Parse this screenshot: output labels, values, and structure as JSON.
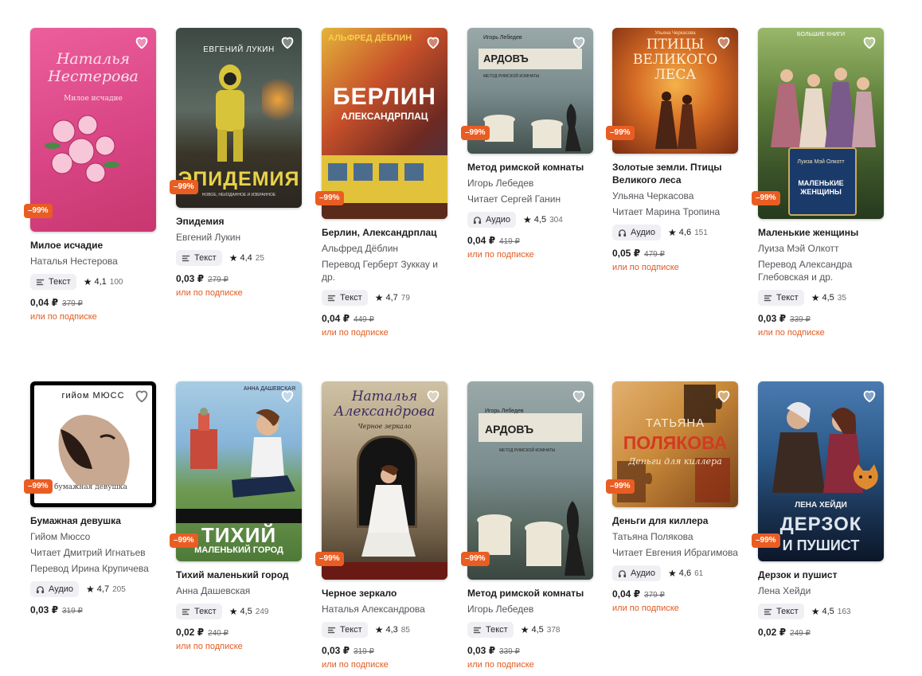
{
  "labels": {
    "subscription": "или по подписке"
  },
  "colors": {
    "discount_badge": "#ea5d22",
    "subscription_link": "#e25b22",
    "chip_bg": "#f0f0f4"
  },
  "books": [
    {
      "cover": {
        "top_text": "Наталья Нестерова",
        "main_text": "Милое исчадие",
        "bottom_text": "",
        "palette": [
          "#e64f91",
          "#c8376f"
        ]
      },
      "discount": "–99%",
      "title": "Милое исчадие",
      "lines": [
        "Наталья Нестерова"
      ],
      "format": {
        "icon": "text-icon",
        "label": "Текст"
      },
      "rating": "4,1",
      "reviews": "100",
      "price": "0,04 ₽",
      "old_price": "379 ₽",
      "subscription": true
    },
    {
      "cover": {
        "top_text": "ЕВГЕНИЙ ЛУКИН",
        "main_text": "ЭПИДЕМИЯ",
        "bottom_text": "новое, неизданное и избранное",
        "palette": [
          "#4a5650",
          "#2a302c"
        ]
      },
      "discount": "–99%",
      "title": "Эпидемия",
      "lines": [
        "Евгений Лукин"
      ],
      "format": {
        "icon": "text-icon",
        "label": "Текст"
      },
      "rating": "4,4",
      "reviews": "25",
      "price": "0,03 ₽",
      "old_price": "279 ₽",
      "subscription": true
    },
    {
      "cover": {
        "top_text": "АЛЬФРЕД ДЁБЛИН",
        "main_text": "БЕРЛИН",
        "bottom_text": "АЛЕКСАНДРПЛАЦ",
        "palette": [
          "#d4a42a",
          "#7a2c1c"
        ]
      },
      "discount": "–99%",
      "title": "Берлин, Александрплац",
      "lines": [
        "Альфред Дёблин",
        "Перевод Герберт Зуккау и др."
      ],
      "format": {
        "icon": "text-icon",
        "label": "Текст"
      },
      "rating": "4,7",
      "reviews": "79",
      "price": "0,04 ₽",
      "old_price": "449 ₽",
      "subscription": true
    },
    {
      "cover": {
        "top_text": "Игорь Лебедев",
        "main_text": "АРДОВЪ",
        "bottom_text": "МЕТОД РИМСКОЙ КОМНАТЫ",
        "palette": [
          "#8a9ba0",
          "#4e5e62"
        ]
      },
      "discount": "–99%",
      "title": "Метод римской комнаты",
      "lines": [
        "Игорь Лебедев",
        "Читает Сергей Ганин"
      ],
      "format": {
        "icon": "headphones-icon",
        "label": "Аудио"
      },
      "rating": "4,5",
      "reviews": "304",
      "price": "0,04 ₽",
      "old_price": "419 ₽",
      "subscription": true
    },
    {
      "cover": {
        "top_text": "Ульяна Черкасова",
        "main_text": "ПТИЦЫ ВЕЛИКОГО ЛЕСА",
        "bottom_text": "",
        "palette": [
          "#e08a2e",
          "#8a3414"
        ]
      },
      "discount": "–99%",
      "title": "Золотые земли. Птицы Великого леса",
      "lines": [
        "Ульяна Черкасова",
        "Читает Марина Тропина"
      ],
      "format": {
        "icon": "headphones-icon",
        "label": "Аудио"
      },
      "rating": "4,6",
      "reviews": "151",
      "price": "0,05 ₽",
      "old_price": "479 ₽",
      "subscription": true
    },
    {
      "cover": {
        "top_text": "БОЛЬШИЕ КНИГИ",
        "main_text": "МАЛЕНЬКИЕ ЖЕНЩИНЫ",
        "bottom_text": "Луиза Мэй Олкотт",
        "palette": [
          "#5e7e3a",
          "#263a1e"
        ]
      },
      "discount": "–99%",
      "title": "Маленькие женщины",
      "lines": [
        "Луиза Мэй Олкотт",
        "Перевод Александра Глебовская и др."
      ],
      "format": {
        "icon": "text-icon",
        "label": "Текст"
      },
      "rating": "4,5",
      "reviews": "35",
      "price": "0,03 ₽",
      "old_price": "339 ₽",
      "subscription": true
    },
    {
      "cover": {
        "top_text": "гийом МЮСС",
        "main_text": "",
        "bottom_text": "бумажная девушка",
        "palette": [
          "#ffffff",
          "#3a2a24"
        ]
      },
      "discount": "–99%",
      "title": "Бумажная девушка",
      "lines": [
        "Гийом Мюссо",
        "Читает Дмитрий Игнатьев",
        "Перевод Ирина Крупичева"
      ],
      "format": {
        "icon": "headphones-icon",
        "label": "Аудио"
      },
      "rating": "4,7",
      "reviews": "205",
      "price": "0,03 ₽",
      "old_price": "319 ₽",
      "subscription": false
    },
    {
      "cover": {
        "top_text": "АННА ДАШЕВСКАЯ",
        "main_text": "ТИХИЙ",
        "bottom_text": "МАЛЕНЬКИЙ ГОРОД",
        "palette": [
          "#7fb3d8",
          "#5b8a3c"
        ]
      },
      "discount": "–99%",
      "title": "Тихий маленький город",
      "lines": [
        "Анна Дашевская"
      ],
      "format": {
        "icon": "text-icon",
        "label": "Текст"
      },
      "rating": "4,5",
      "reviews": "249",
      "price": "0,02 ₽",
      "old_price": "240 ₽",
      "subscription": true
    },
    {
      "cover": {
        "top_text": "Наталья Александрова",
        "main_text": "Черное зеркало",
        "bottom_text": "",
        "palette": [
          "#b8a98a",
          "#5a4a34"
        ]
      },
      "discount": "–99%",
      "title": "Черное зеркало",
      "lines": [
        "Наталья Александрова"
      ],
      "format": {
        "icon": "text-icon",
        "label": "Текст"
      },
      "rating": "4,3",
      "reviews": "85",
      "price": "0,03 ₽",
      "old_price": "319 ₽",
      "subscription": true
    },
    {
      "cover": {
        "top_text": "Игорь Лебедев",
        "main_text": "АРДОВЪ",
        "bottom_text": "МЕТОД РИМСКОЙ КОМНАТЫ",
        "palette": [
          "#8a9ba0",
          "#4e5e62"
        ]
      },
      "discount": "–99%",
      "title": "Метод римской комнаты",
      "lines": [
        "Игорь Лебедев"
      ],
      "format": {
        "icon": "text-icon",
        "label": "Текст"
      },
      "rating": "4,5",
      "reviews": "378",
      "price": "0,03 ₽",
      "old_price": "339 ₽",
      "subscription": true
    },
    {
      "cover": {
        "top_text": "ТАТЬЯНА",
        "main_text": "ПОЛЯКОВА",
        "bottom_text": "Деньги для киллера",
        "palette": [
          "#c98a3a",
          "#7a4218"
        ]
      },
      "discount": "–99%",
      "title": "Деньги для киллера",
      "lines": [
        "Татьяна Полякова",
        "Читает Евгения Ибрагимова"
      ],
      "format": {
        "icon": "headphones-icon",
        "label": "Аудио"
      },
      "rating": "4,6",
      "reviews": "61",
      "price": "0,04 ₽",
      "old_price": "379 ₽",
      "subscription": true
    },
    {
      "cover": {
        "top_text": "ЛЕНА ХЕЙДИ",
        "main_text": "ДЕРЗОК",
        "bottom_text": "И ПУШИСТ",
        "palette": [
          "#2c5a8a",
          "#101c34"
        ]
      },
      "discount": "–99%",
      "title": "Дерзок и пушист",
      "lines": [
        "Лена Хейди"
      ],
      "format": {
        "icon": "text-icon",
        "label": "Текст"
      },
      "rating": "4,5",
      "reviews": "163",
      "price": "0,02 ₽",
      "old_price": "249 ₽",
      "subscription": false
    }
  ]
}
